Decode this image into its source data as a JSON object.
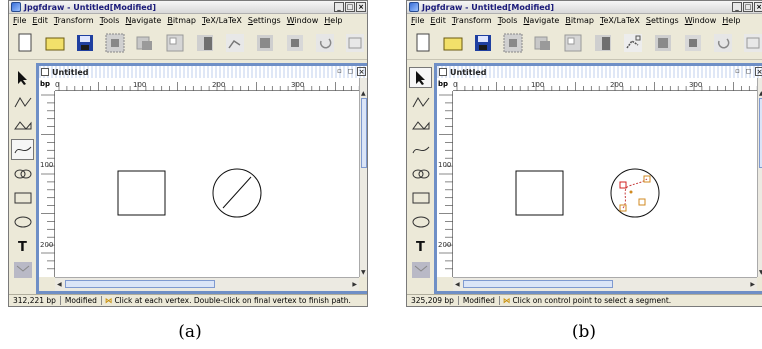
{
  "window": {
    "title": "Jpgfdraw - Untitled[Modified]"
  },
  "menu": [
    "File",
    "Edit",
    "Transform",
    "Tools",
    "Navigate",
    "Bitmap",
    "TeX/LaTeX",
    "Settings",
    "Window",
    "Help"
  ],
  "document": {
    "title": "Untitled",
    "ruler_unit": "bp",
    "ruler_h_labels": [
      "0",
      "100",
      "200",
      "300"
    ],
    "ruler_v_labels": [
      "100",
      "200"
    ]
  },
  "panel_a": {
    "status_coord": "312,221 bp",
    "status_modified": "Modified",
    "status_message": "Click at each vertex. Double-click on final vertex to finish path.",
    "caption": "(a)"
  },
  "panel_b": {
    "status_coord": "325,209 bp",
    "status_modified": "Modified",
    "status_message": "Click on control point to select a segment.",
    "caption": "(b)"
  },
  "icons": {
    "toolbar": [
      "new-file-icon",
      "open-folder-icon",
      "save-disk-icon",
      "zoom-selection-icon",
      "move-forward-icon",
      "move-back-icon",
      "image-icon",
      "edit-path-icon",
      "frame-icon",
      "square-icon",
      "undo-icon",
      "box-icon"
    ],
    "toolbox": [
      "select-arrow-icon",
      "open-line-icon",
      "closed-line-icon",
      "curve-icon",
      "loop-icon",
      "rectangle-icon",
      "ellipse-icon",
      "text-icon",
      "math-icon"
    ]
  },
  "colors": {
    "doc_frame": "#6f8fc6",
    "title_text": "#1a1a7a",
    "control_point": "#d08a20",
    "selected_point": "#d02020"
  }
}
